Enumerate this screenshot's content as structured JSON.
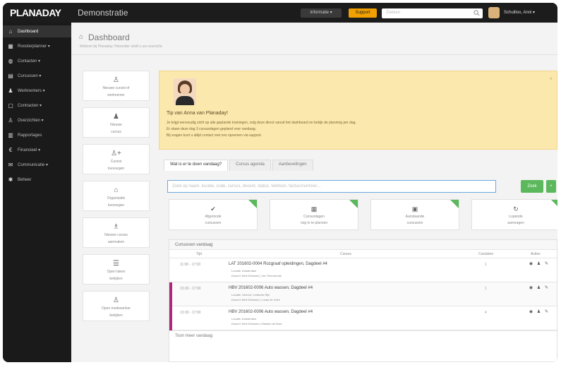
{
  "app": {
    "logo": "PLANADAY",
    "title": "Demonstratie"
  },
  "topbar": {
    "info_label": "Informatie ▾",
    "support_label": "Support",
    "search_placeholder": "Zoeken",
    "user_name": "Schuilloo, Anni ▾"
  },
  "sidebar": {
    "items": [
      {
        "icon": "dashboard-icon",
        "glyph": "⌂",
        "label": "Dashboard",
        "active": true
      },
      {
        "icon": "calendar-icon",
        "glyph": "▦",
        "label": "Roosterplanner ▾"
      },
      {
        "icon": "users-icon",
        "glyph": "◍",
        "label": "Contacten ▾"
      },
      {
        "icon": "building-icon",
        "glyph": "▤",
        "label": "Cursussen ▾"
      },
      {
        "icon": "person-icon",
        "glyph": "♟",
        "label": "Werknemers ▾"
      },
      {
        "icon": "docs-icon",
        "glyph": "▢",
        "label": "Contracten ▾"
      },
      {
        "icon": "group-icon",
        "glyph": "♙",
        "label": "Overzichten ▾"
      },
      {
        "icon": "chart-icon",
        "glyph": "▥",
        "label": "Rapportages"
      },
      {
        "icon": "euro-icon",
        "glyph": "€",
        "label": "Financieel ▾"
      },
      {
        "icon": "message-icon",
        "glyph": "✉",
        "label": "Communicatie ▾"
      },
      {
        "icon": "settings-icon",
        "glyph": "✱",
        "label": "Beheer"
      }
    ]
  },
  "page": {
    "title": "Dashboard",
    "subtitle": "Welkom bij Planaday. Hieronder vindt u uw overzicht."
  },
  "quick_actions": [
    {
      "icon": "user-icon",
      "glyph": "♙",
      "line1": "Nieuwe cursist of",
      "line2": "werknemer"
    },
    {
      "icon": "person-icon",
      "glyph": "♟",
      "line1": "Nieuwe",
      "line2": "cursus"
    },
    {
      "icon": "user-plus-icon",
      "glyph": "♙+",
      "line1": "Cursist",
      "line2": "toevoegen"
    },
    {
      "icon": "building-icon",
      "glyph": "⌂",
      "line1": "Organisatie",
      "line2": "toevoegen"
    },
    {
      "icon": "group-icon",
      "glyph": "♗",
      "line1": "Nieuwe cursus",
      "line2": "aanmaken"
    },
    {
      "icon": "list-icon",
      "glyph": "☰",
      "line1": "Open taken",
      "line2": "bekijken"
    },
    {
      "icon": "user-icon",
      "glyph": "♙",
      "line1": "Open medewerker",
      "line2": "bekijken"
    }
  ],
  "tip": {
    "title": "Tip van Anna van Planaday!",
    "lines": [
      "Je krijgt eenvoudig zicht op alle geplande trainingen, volg deze direct vanuit het dashboard en bekijk de planning per dag.",
      "Er staan deze dag 3 cursusdagen gepland voor vandaag.",
      "Bij vragen kunt u altijd contact met ons opnemen via support."
    ]
  },
  "tabs": [
    {
      "label": "Wat is er te doen vandaag?",
      "active": true
    },
    {
      "label": "Cursus agenda"
    },
    {
      "label": "Aanbevelingen"
    }
  ],
  "filter": {
    "placeholder": "Zoek op naam, locatie, code, cursus, docent, status, telefoon, factuurnummer...",
    "search_button": "Zoek",
    "add_button": "+"
  },
  "stats": [
    {
      "icon": "check-icon",
      "glyph": "✔",
      "line1": "Afgeronde",
      "line2": "cursussen"
    },
    {
      "icon": "calendar-icon",
      "glyph": "▦",
      "line1": "Cursusdagen",
      "line2": "nog in te plannen"
    },
    {
      "icon": "calendar-range-icon",
      "glyph": "▣",
      "line1": "Aanstaande",
      "line2": "cursussen"
    },
    {
      "icon": "refresh-icon",
      "glyph": "↻",
      "line1": "Lopende",
      "line2": "aanvragen"
    }
  ],
  "panel": {
    "title": "Cursussen vandaag",
    "columns": {
      "time": "Tijd",
      "course": "Cursus",
      "count": "Cursisten",
      "actions": "Acties"
    },
    "rows": [
      {
        "time": "11:00 - 17:00",
        "title": "LAT 201602-0004 Rozgraaf opleidingen, Dagdeel #4",
        "line1": "Locatie: Amsterdam",
        "line2": "Docent: Bert Driessen | Jan Timmerman",
        "count": "1",
        "marked": false
      },
      {
        "time": "13:30 - 17:00",
        "title": "HBV 201602-0006 Auto wassen, Dagdeel #4",
        "line1": "Locatie: Utrecht, Leidsche Rijn",
        "line2": "Docent: Bert Driessen | Lucas de Vries",
        "count": "1",
        "marked": true
      },
      {
        "time": "13:30 - 17:00",
        "title": "HBV 201602-0006 Auto wassen, Dagdeel #4",
        "line1": "Locatie: Amsterdam",
        "line2": "Docent: Bert Driessen | Marieke de Boer",
        "count": "4",
        "marked": true
      }
    ],
    "footer": "Toon meer vandaag"
  }
}
